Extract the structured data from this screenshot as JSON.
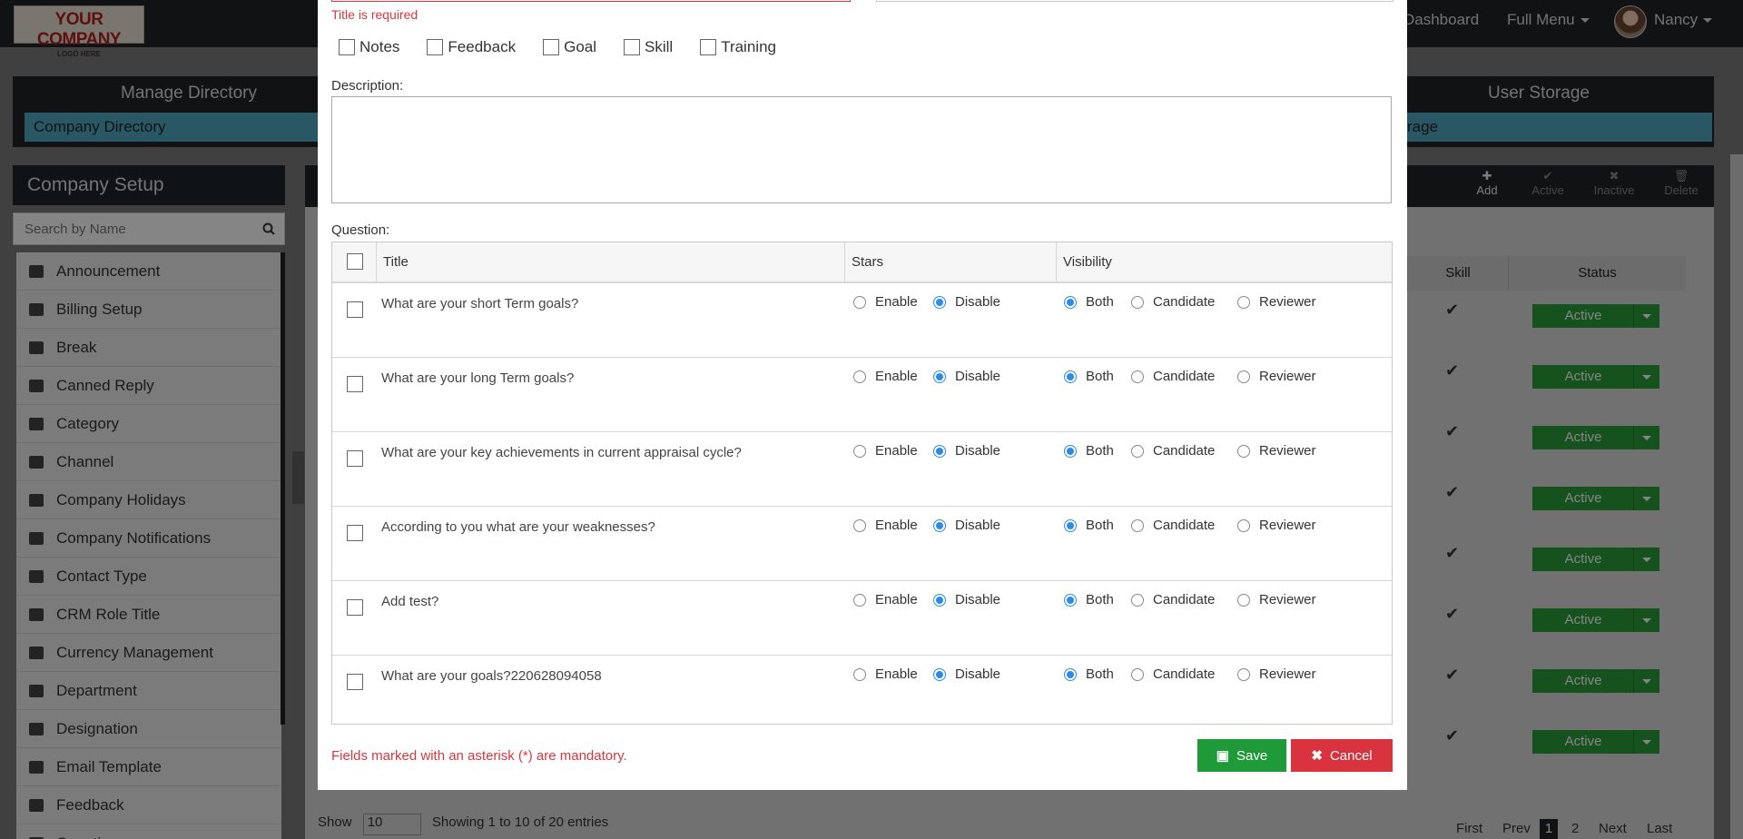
{
  "logo": {
    "line1": "YOUR COMPANY",
    "line2": "LOGO HERE"
  },
  "topnav": {
    "dashboard": "Dashboard",
    "full_menu": "Full Menu",
    "user": "Nancy"
  },
  "directory": {
    "manage_title": "Manage Directory",
    "company_directory": "Company Directory",
    "user_storage_title": "User Storage",
    "storage_link": "rage"
  },
  "sidebar": {
    "title": "Company Setup",
    "search_placeholder": "Search by Name",
    "items": [
      {
        "label": "Announcement",
        "icon": "megaphone-icon"
      },
      {
        "label": "Billing Setup",
        "icon": "dollar-icon"
      },
      {
        "label": "Break",
        "icon": "clock-icon"
      },
      {
        "label": "Canned Reply",
        "icon": "envelope-icon"
      },
      {
        "label": "Category",
        "icon": "list-icon"
      },
      {
        "label": "Channel",
        "icon": "monitor-icon"
      },
      {
        "label": "Company Holidays",
        "icon": "calendar-icon"
      },
      {
        "label": "Company Notifications",
        "icon": "bell-icon"
      },
      {
        "label": "Contact Type",
        "icon": "card-icon"
      },
      {
        "label": "CRM Role Title",
        "icon": "user-icon"
      },
      {
        "label": "Currency Management",
        "icon": "money-icon"
      },
      {
        "label": "Department",
        "icon": "users-icon"
      },
      {
        "label": "Designation",
        "icon": "id-card-icon"
      },
      {
        "label": "Email Template",
        "icon": "file-icon"
      },
      {
        "label": "Feedback",
        "icon": "quote-icon"
      },
      {
        "label": "Question",
        "icon": "question-icon"
      }
    ]
  },
  "toolbar": {
    "add": "Add",
    "active": "Active",
    "inactive": "Inactive",
    "delete": "Delete"
  },
  "grid": {
    "headers": {
      "skill": "Skill",
      "status": "Status"
    },
    "status_label": "Active",
    "show_label": "Show",
    "page_size": "10",
    "entries_info": "Showing 1 to 10 of 20 entries",
    "pager": {
      "first": "First",
      "prev": "Prev",
      "p1": "1",
      "p2": "2",
      "next": "Next",
      "last": "Last"
    }
  },
  "modal": {
    "title_error": "Title is required",
    "types": [
      "Notes",
      "Feedback",
      "Goal",
      "Skill",
      "Training"
    ],
    "description_label": "Description:",
    "question_label": "Question:",
    "table_headers": {
      "title": "Title",
      "stars": "Stars",
      "visibility": "Visibility"
    },
    "star_options": {
      "enable": "Enable",
      "disable": "Disable"
    },
    "visibility_options": {
      "both": "Both",
      "candidate": "Candidate",
      "reviewer": "Reviewer"
    },
    "questions": [
      {
        "title": "What are your short Term goals?",
        "stars": "Disable",
        "visibility": "Both"
      },
      {
        "title": "What are your long Term goals?",
        "stars": "Disable",
        "visibility": "Both"
      },
      {
        "title": "What are your key achievements in current appraisal cycle?",
        "stars": "Disable",
        "visibility": "Both"
      },
      {
        "title": "According to you what are your weaknesses?",
        "stars": "Disable",
        "visibility": "Both"
      },
      {
        "title": "Add test?",
        "stars": "Disable",
        "visibility": "Both"
      },
      {
        "title": "What are your goals?220628094058",
        "stars": "Disable",
        "visibility": "Both"
      }
    ],
    "mandatory_note": "Fields marked with an asterisk (*) are mandatory.",
    "save_label": "Save",
    "cancel_label": "Cancel"
  }
}
